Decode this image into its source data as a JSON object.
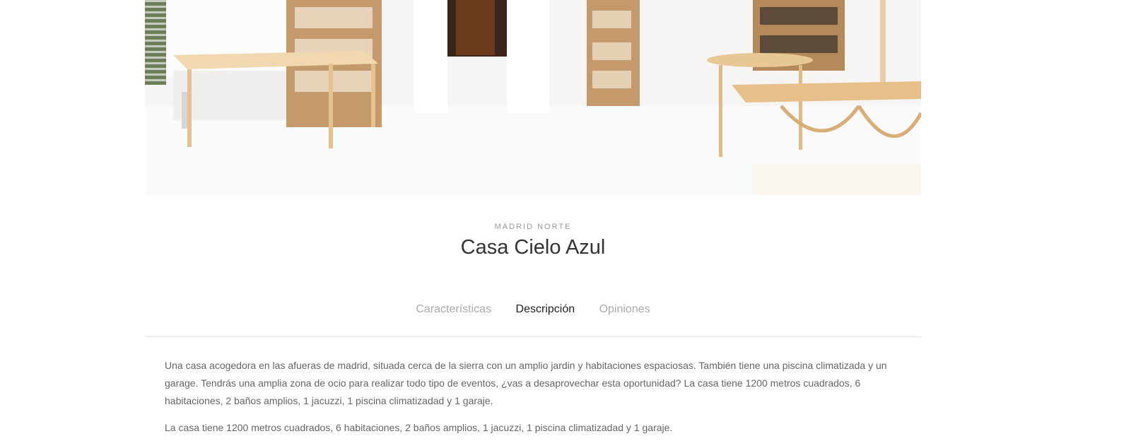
{
  "property": {
    "location": "MADRID NORTE",
    "title": "Casa Cielo Azul"
  },
  "tabs": [
    {
      "label": "Características",
      "active": false
    },
    {
      "label": "Descripción",
      "active": true
    },
    {
      "label": "Opiniones",
      "active": false
    }
  ],
  "description": {
    "paragraph1": "Una casa acogedora en las afueras de madrid, situada cerca de la sierra con un amplio jardin y habitaciones espaciosas. También tiene una piscina climatizada y un garage. Tendrás una amplia zona de ocio para realizar todo tipo de eventos, ¿vas a desaprovechar esta oportunidad? La casa tiene 1200 metros cuadrados, 6 habitaciones, 2 baños amplios, 1 jacuzzi, 1 piscina climatizadad y 1 garaje.",
    "paragraph2": "La casa tiene 1200 metros cuadrados, 6 habitaciones, 2 baños amplios, 1 jacuzzi, 1 piscina climatizadad y 1 garaje."
  }
}
